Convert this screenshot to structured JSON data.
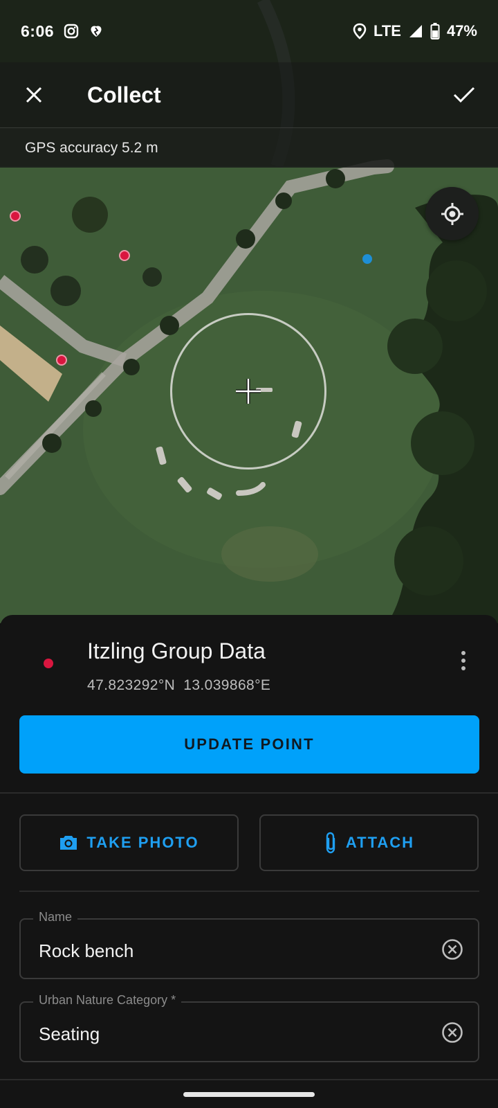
{
  "status_bar": {
    "time": "6:06",
    "network": "LTE",
    "battery": "47%"
  },
  "app_bar": {
    "title": "Collect",
    "close_icon": "close-icon",
    "confirm_icon": "check-icon"
  },
  "gps": {
    "accuracy_text": "GPS accuracy 5.2 m"
  },
  "map": {
    "locate_icon": "gps-target-icon",
    "crosshair_icon": "crosshair-icon"
  },
  "feature": {
    "layer_name": "Itzling Group Data",
    "latitude": "47.823292°N",
    "longitude": "13.039868°E",
    "layer_color": "#d9163f"
  },
  "actions": {
    "update_point": "UPDATE POINT",
    "take_photo": "TAKE PHOTO",
    "attach": "ATTACH"
  },
  "form": {
    "fields": [
      {
        "label": "Name",
        "value": "Rock bench"
      },
      {
        "label": "Urban Nature Category *",
        "value": "Seating"
      }
    ]
  },
  "colors": {
    "accent": "#00a1fa",
    "accent_text": "#1f9ff1",
    "sheet_bg": "#141414",
    "point_red": "#d9163f",
    "point_blue": "#1e8fd6"
  }
}
